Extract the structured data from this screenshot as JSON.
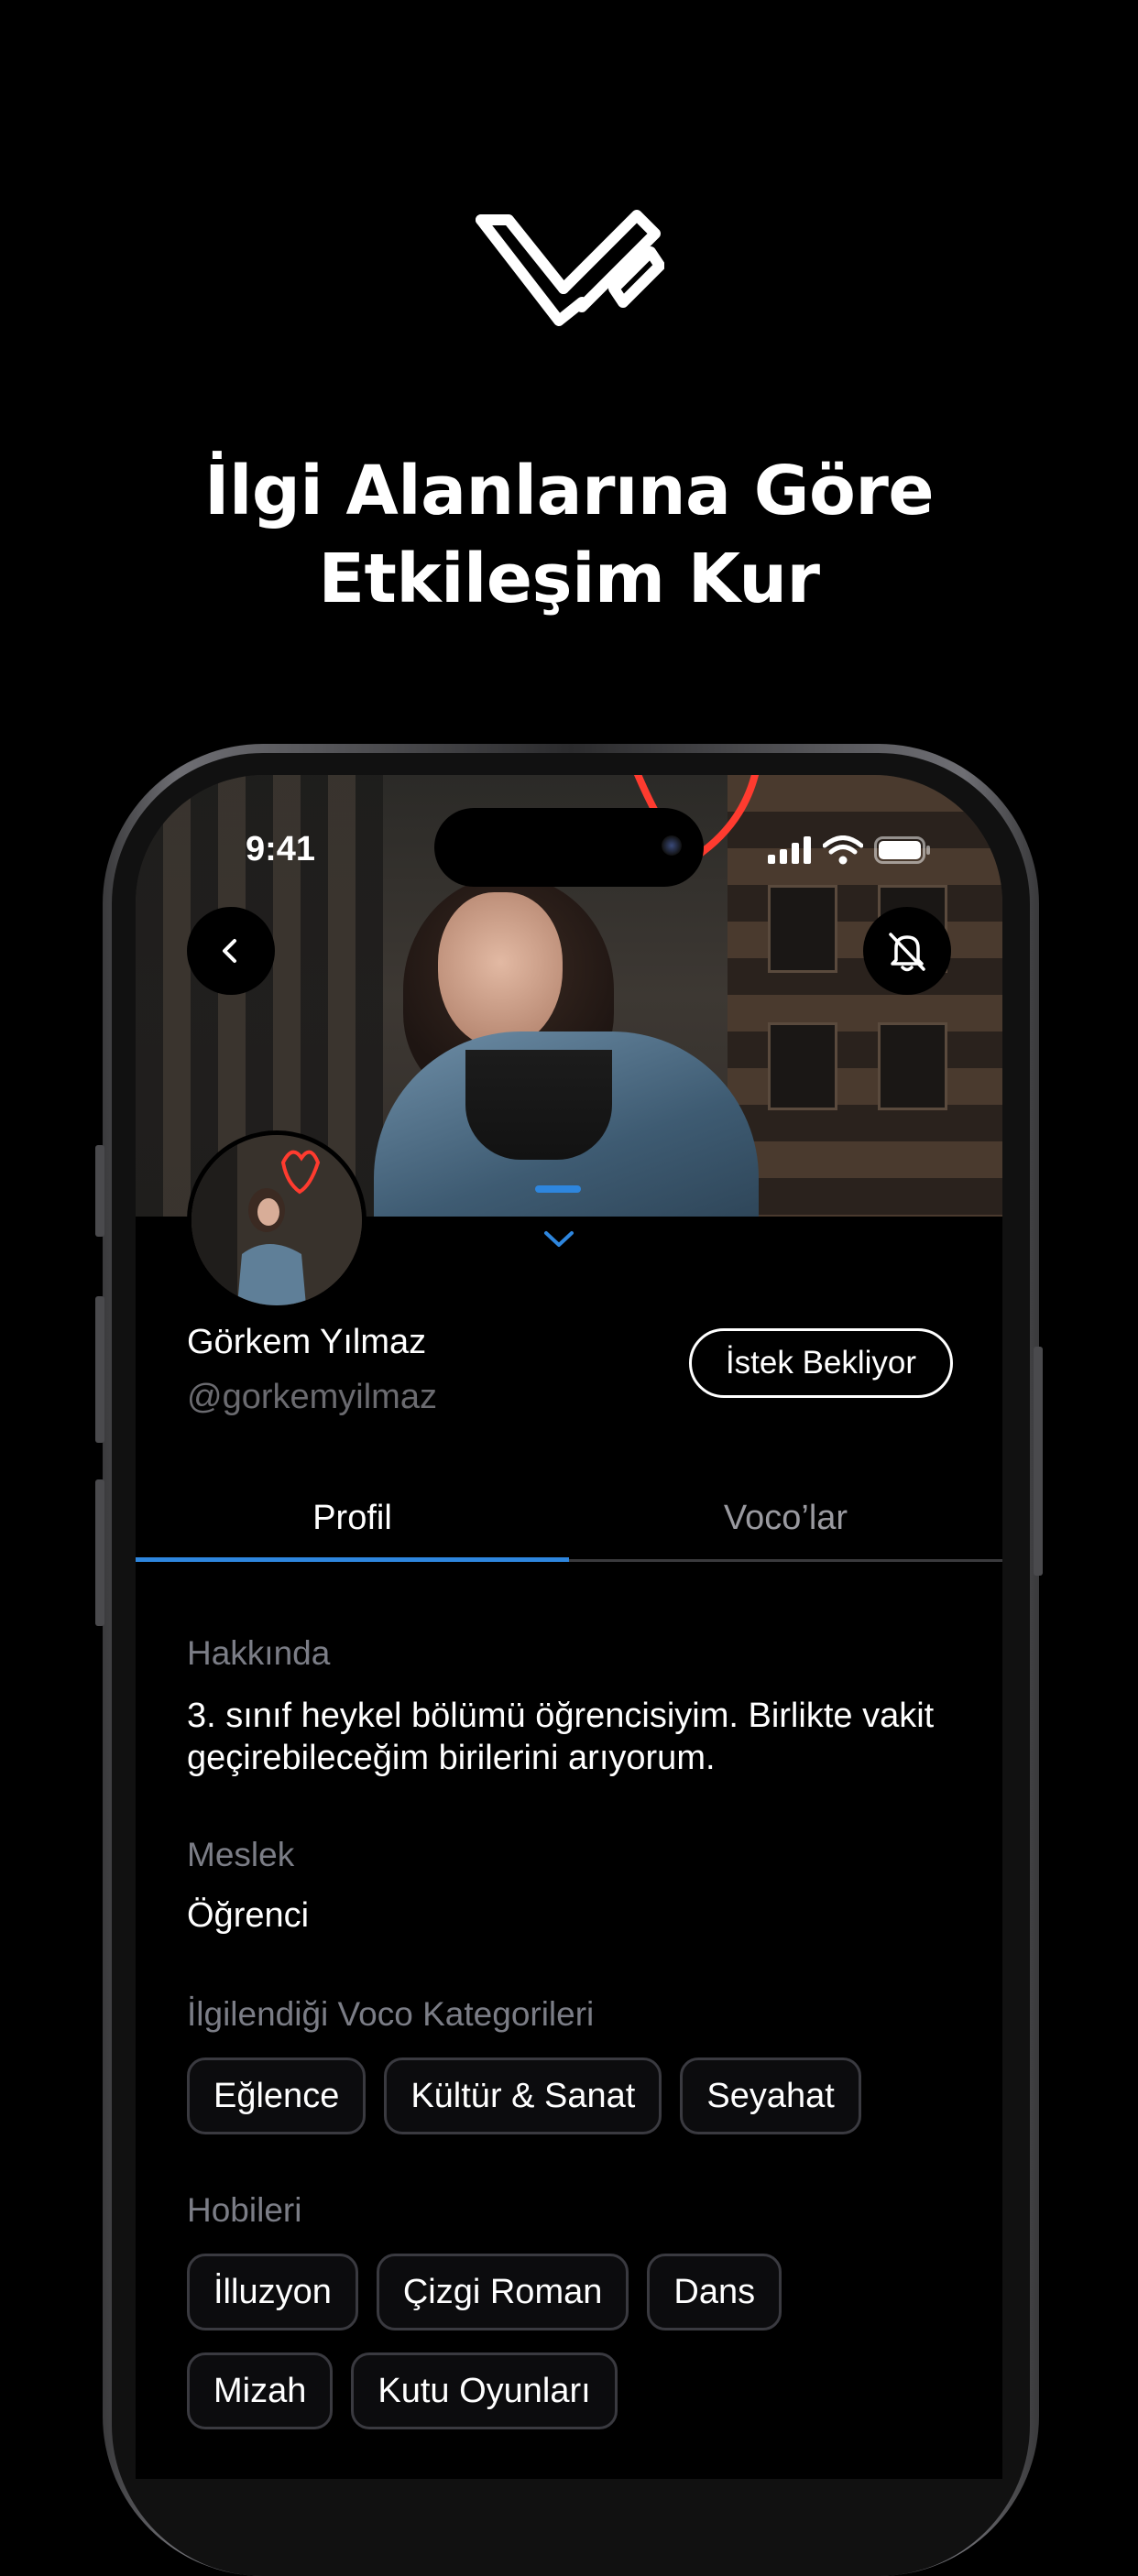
{
  "headline": {
    "line1": "İlgi Alanlarına Göre",
    "line2": "Etkileşim Kur"
  },
  "status_bar": {
    "time": "9:41"
  },
  "profile": {
    "name": "Görkem Yılmaz",
    "handle": "@gorkemyilmaz",
    "request_button": "İstek Bekliyor"
  },
  "tabs": {
    "profile": "Profil",
    "vocos": "Voco’lar"
  },
  "sections": {
    "about_label": "Hakkında",
    "about_text": "3. sınıf heykel bölümü öğrencisiyim. Birlikte vakit geçirebileceğim birilerini arıyorum.",
    "job_label": "Meslek",
    "job_value": "Öğrenci",
    "categories_label": "İlgilendiği Voco Kategorileri",
    "categories": [
      "Eğlence",
      "Kültür & Sanat",
      "Seyahat"
    ],
    "hobbies_label": "Hobileri",
    "hobbies_row1": [
      "İlluzyon",
      "Çizgi Roman",
      "Dans"
    ],
    "hobbies_row2": [
      "Mizah",
      "Kutu Oyunları"
    ]
  },
  "icons": {
    "logo": "voco-logo-icon",
    "back": "chevron-left-icon",
    "mute": "bell-off-icon",
    "expand": "chevron-down-icon",
    "signal": "cellular-signal-icon",
    "wifi": "wifi-icon",
    "battery": "battery-icon"
  },
  "colors": {
    "accent": "#2e86de",
    "background": "#000000",
    "muted_text": "#7b7d86"
  }
}
